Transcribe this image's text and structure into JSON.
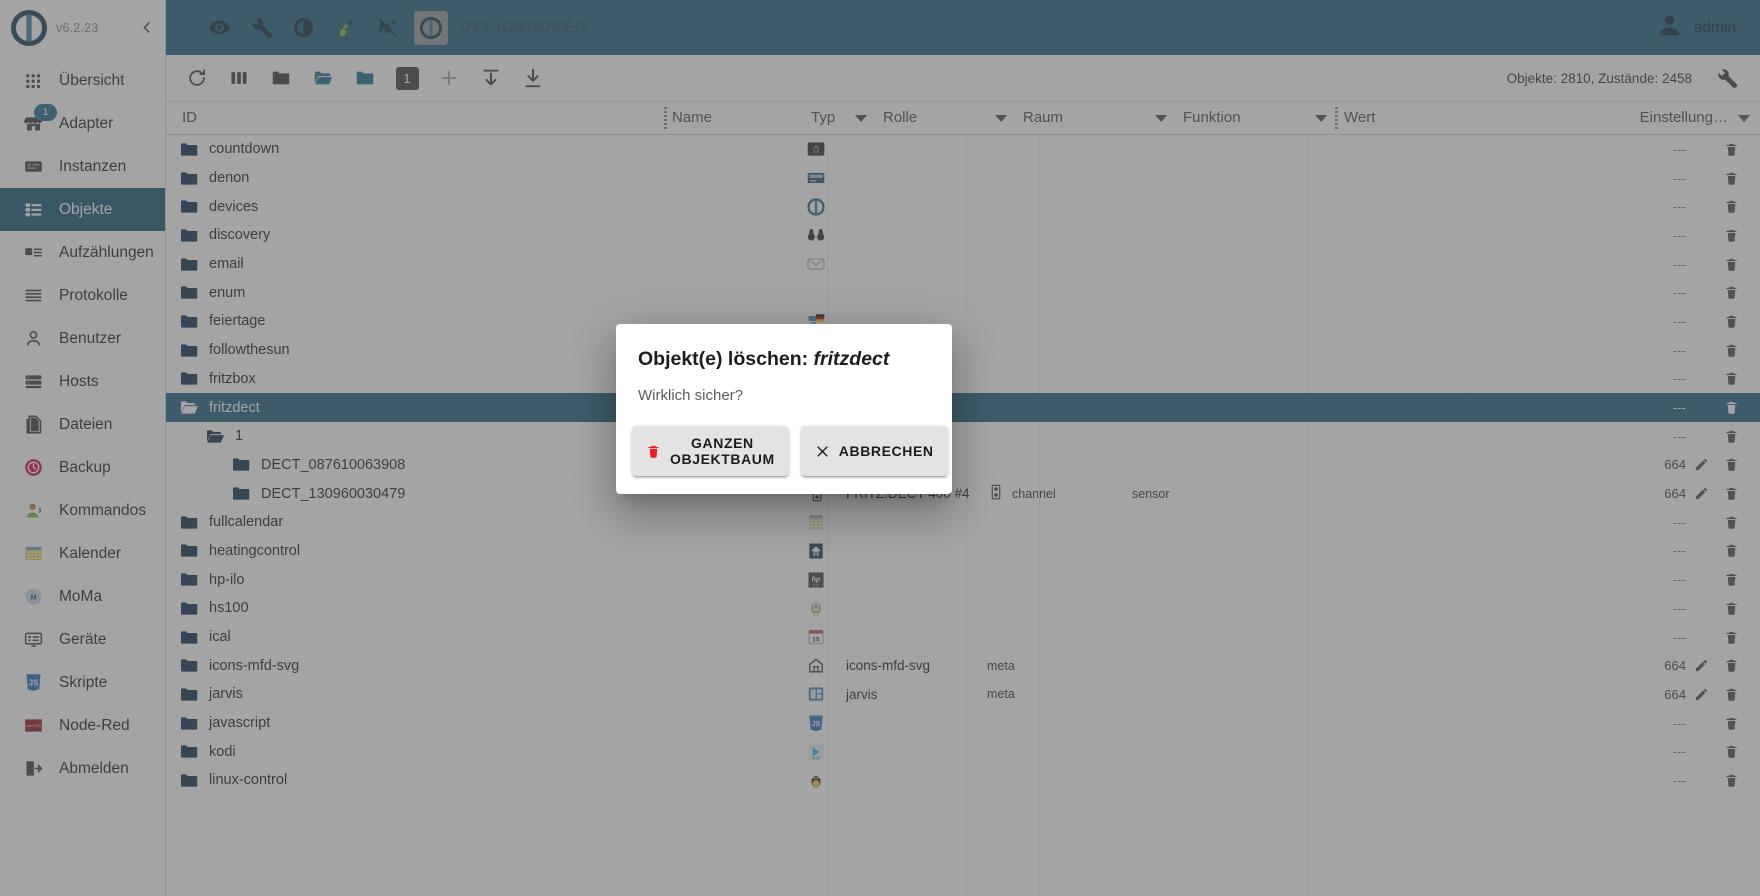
{
  "app": {
    "version": "v6.2.23",
    "host_name": "D11-IOBROKER",
    "user": "admin",
    "accent": "#1b5e7d",
    "sidebar_active": "#155572"
  },
  "sidebar": {
    "collapse_icon": "chevron-left-icon",
    "items": [
      {
        "label": "Übersicht",
        "icon": "apps-grid-icon",
        "badge": "",
        "active": false
      },
      {
        "label": "Adapter",
        "icon": "store-icon",
        "badge": "1",
        "active": false
      },
      {
        "label": "Instanzen",
        "icon": "instances-icon",
        "badge": "",
        "active": false
      },
      {
        "label": "Objekte",
        "icon": "list-icon",
        "badge": "",
        "active": true
      },
      {
        "label": "Aufzählungen",
        "icon": "enum-icon",
        "badge": "",
        "active": false
      },
      {
        "label": "Protokolle",
        "icon": "log-lines-icon",
        "badge": "",
        "active": false
      },
      {
        "label": "Benutzer",
        "icon": "person-icon",
        "badge": "",
        "active": false
      },
      {
        "label": "Hosts",
        "icon": "server-icon",
        "badge": "",
        "active": false
      },
      {
        "label": "Dateien",
        "icon": "files-icon",
        "badge": "",
        "active": false
      },
      {
        "label": "Backup",
        "icon": "backup-clock-icon",
        "badge": "",
        "active": false
      },
      {
        "label": "Kommandos",
        "icon": "commands-icon",
        "badge": "",
        "active": false
      },
      {
        "label": "Kalender",
        "icon": "calendar-icon",
        "badge": "",
        "active": false
      },
      {
        "label": "MoMa",
        "icon": "moma-icon",
        "badge": "",
        "active": false
      },
      {
        "label": "Geräte",
        "icon": "devices-icon",
        "badge": "",
        "active": false
      },
      {
        "label": "Skripte",
        "icon": "javascript-icon",
        "badge": "",
        "active": false
      },
      {
        "label": "Node-Red",
        "icon": "node-red-icon",
        "badge": "",
        "active": false
      },
      {
        "label": "Abmelden",
        "icon": "logout-icon",
        "badge": "",
        "active": false
      }
    ]
  },
  "topbar": {
    "icons": [
      "eye-icon",
      "wrench-icon",
      "brightness-icon",
      "expert-mode-icon",
      "no-sync-icon"
    ],
    "host_icon": "iobroker-logo-icon",
    "user_icon": "user-avatar-icon"
  },
  "objects_toolbar": {
    "icons": [
      "refresh-icon",
      "columns-icon",
      "collapse-all-folders-icon",
      "expand-all-folders-icon",
      "folder-filled-icon"
    ],
    "depth_value": "1",
    "add_icon": "plus-icon",
    "import_icon": "upload-icon",
    "export_icon": "download-icon",
    "counts": "Objekte: 2810, Zustände: 2458",
    "settings_icon": "wrench-icon"
  },
  "columns": [
    {
      "key": "id",
      "label": "ID"
    },
    {
      "key": "name",
      "label": "Name"
    },
    {
      "key": "typ",
      "label": "Typ"
    },
    {
      "key": "rolle",
      "label": "Rolle"
    },
    {
      "key": "raum",
      "label": "Raum"
    },
    {
      "key": "funktion",
      "label": "Funktion"
    },
    {
      "key": "wert",
      "label": "Wert"
    },
    {
      "key": "einst",
      "label": "Einstellung…"
    }
  ],
  "rows": [
    {
      "id": "countdown",
      "indent": 0,
      "folder": "closed",
      "name": "",
      "icon": "countdown-icon",
      "typ": "",
      "rolle": "",
      "value": "---",
      "edit": false,
      "del": true,
      "selected": false
    },
    {
      "id": "denon",
      "indent": 0,
      "folder": "closed",
      "name": "",
      "icon": "denon-icon",
      "typ": "",
      "rolle": "",
      "value": "---",
      "edit": false,
      "del": true,
      "selected": false
    },
    {
      "id": "devices",
      "indent": 0,
      "folder": "closed",
      "name": "",
      "icon": "iobroker-icon",
      "typ": "",
      "rolle": "",
      "value": "---",
      "edit": false,
      "del": true,
      "selected": false
    },
    {
      "id": "discovery",
      "indent": 0,
      "folder": "closed",
      "name": "",
      "icon": "binoculars-icon",
      "typ": "",
      "rolle": "",
      "value": "---",
      "edit": false,
      "del": true,
      "selected": false
    },
    {
      "id": "email",
      "indent": 0,
      "folder": "closed",
      "name": "",
      "icon": "envelope-icon",
      "typ": "",
      "rolle": "",
      "value": "---",
      "edit": false,
      "del": true,
      "selected": false
    },
    {
      "id": "enum",
      "indent": 0,
      "folder": "closed",
      "name": "",
      "icon": "",
      "typ": "",
      "rolle": "",
      "value": "---",
      "edit": false,
      "del": true,
      "selected": false
    },
    {
      "id": "feiertage",
      "indent": 0,
      "folder": "closed",
      "name": "",
      "icon": "feiertage-icon",
      "typ": "",
      "rolle": "",
      "value": "---",
      "edit": false,
      "del": true,
      "selected": false
    },
    {
      "id": "followthesun",
      "indent": 0,
      "folder": "closed",
      "name": "",
      "icon": "",
      "typ": "",
      "rolle": "",
      "value": "---",
      "edit": false,
      "del": true,
      "selected": false
    },
    {
      "id": "fritzbox",
      "indent": 0,
      "folder": "closed",
      "name": "",
      "icon": "",
      "typ": "",
      "rolle": "",
      "value": "---",
      "edit": false,
      "del": true,
      "selected": false
    },
    {
      "id": "fritzdect",
      "indent": 0,
      "folder": "open",
      "name": "",
      "icon": "",
      "typ": "",
      "rolle": "",
      "value": "---",
      "edit": false,
      "del": true,
      "selected": true
    },
    {
      "id": "1",
      "indent": 1,
      "folder": "open",
      "name": "",
      "icon": "",
      "typ": "",
      "rolle": "",
      "value": "---",
      "edit": false,
      "del": true,
      "selected": false
    },
    {
      "id": "DECT_087610063908",
      "indent": 2,
      "folder": "closed",
      "name": "",
      "icon": "",
      "typ": "",
      "rolle": "",
      "value": "664",
      "edit": true,
      "del": true,
      "selected": false
    },
    {
      "id": "DECT_130960030479",
      "indent": 2,
      "folder": "closed",
      "name": "FRITZ!DECT 400 #4",
      "icon": "channel-icon",
      "typ": "channel",
      "rolle": "sensor",
      "value": "664",
      "edit": true,
      "del": true,
      "selected": false
    },
    {
      "id": "fullcalendar",
      "indent": 0,
      "folder": "closed",
      "name": "",
      "icon": "fullcalendar-icon",
      "typ": "",
      "rolle": "",
      "value": "---",
      "edit": false,
      "del": true,
      "selected": false
    },
    {
      "id": "heatingcontrol",
      "indent": 0,
      "folder": "closed",
      "name": "",
      "icon": "heating-icon",
      "typ": "",
      "rolle": "",
      "value": "---",
      "edit": false,
      "del": true,
      "selected": false
    },
    {
      "id": "hp-ilo",
      "indent": 0,
      "folder": "closed",
      "name": "",
      "icon": "hp-ilo-icon",
      "typ": "",
      "rolle": "",
      "value": "---",
      "edit": false,
      "del": true,
      "selected": false
    },
    {
      "id": "hs100",
      "indent": 0,
      "folder": "closed",
      "name": "",
      "icon": "hs100-icon",
      "typ": "",
      "rolle": "",
      "value": "---",
      "edit": false,
      "del": true,
      "selected": false
    },
    {
      "id": "ical",
      "indent": 0,
      "folder": "closed",
      "name": "",
      "icon": "ical-icon",
      "typ": "",
      "rolle": "",
      "value": "---",
      "edit": false,
      "del": true,
      "selected": false
    },
    {
      "id": "icons-mfd-svg",
      "indent": 0,
      "folder": "closed",
      "name": "icons-mfd-svg",
      "icon": "mfd-icon",
      "typ": "meta",
      "rolle": "",
      "value": "664",
      "edit": true,
      "del": true,
      "selected": false
    },
    {
      "id": "jarvis",
      "indent": 0,
      "folder": "closed",
      "name": "jarvis",
      "icon": "jarvis-icon",
      "typ": "meta",
      "rolle": "",
      "value": "664",
      "edit": true,
      "del": true,
      "selected": false
    },
    {
      "id": "javascript",
      "indent": 0,
      "folder": "closed",
      "name": "",
      "icon": "javascript-icon",
      "typ": "",
      "rolle": "",
      "value": "---",
      "edit": false,
      "del": true,
      "selected": false
    },
    {
      "id": "kodi",
      "indent": 0,
      "folder": "closed",
      "name": "",
      "icon": "kodi-icon",
      "typ": "",
      "rolle": "",
      "value": "---",
      "edit": false,
      "del": true,
      "selected": false
    },
    {
      "id": "linux-control",
      "indent": 0,
      "folder": "closed",
      "name": "",
      "icon": "linux-icon",
      "typ": "",
      "rolle": "",
      "value": "---",
      "edit": false,
      "del": true,
      "selected": false
    }
  ],
  "dialog": {
    "title_prefix": "Objekt(e) löschen:",
    "title_object": "fritzdect",
    "message": "Wirklich sicher?",
    "confirm_label": "GANZEN OBJEKTBAUM",
    "confirm_icon": "trash-icon",
    "cancel_label": "ABBRECHEN",
    "cancel_icon": "close-x-icon"
  }
}
